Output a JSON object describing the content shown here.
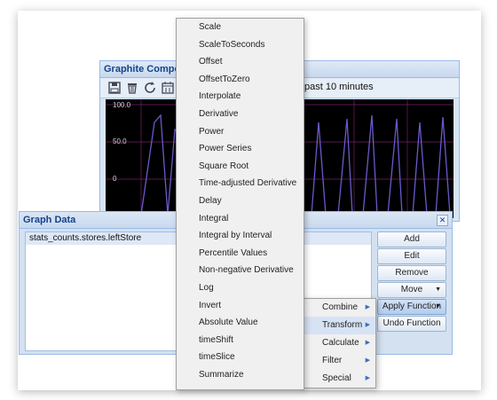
{
  "composer": {
    "title": "Graphite Composer",
    "time_label": "past 10 minutes",
    "toolbar_icons": [
      "save-icon",
      "trash-icon",
      "refresh-icon",
      "calendar-icon"
    ],
    "y_ticks": [
      "100.0",
      "50.0",
      "0"
    ],
    "line_color": "#6a5acd",
    "background_color": "#000000"
  },
  "graph_data": {
    "title": "Graph Data",
    "series": [
      "stats_counts.stores.leftStore"
    ],
    "buttons": {
      "add": "Add",
      "edit": "Edit",
      "remove": "Remove",
      "move": "Move",
      "apply_function": "Apply Function",
      "undo_function": "Undo Function"
    }
  },
  "apply_menu": {
    "items": [
      "Combine",
      "Transform",
      "Calculate",
      "Filter",
      "Special"
    ],
    "highlighted": "Transform"
  },
  "transform_menu": {
    "items": [
      "Scale",
      "ScaleToSeconds",
      "Offset",
      "OffsetToZero",
      "Interpolate",
      "Derivative",
      "Power",
      "Power Series",
      "Square Root",
      "Time-adjusted Derivative",
      "Delay",
      "Integral",
      "Integral by Interval",
      "Percentile Values",
      "Non-negative Derivative",
      "Log",
      "Invert",
      "Absolute Value",
      "timeShift",
      "timeSlice",
      "Summarize"
    ]
  }
}
